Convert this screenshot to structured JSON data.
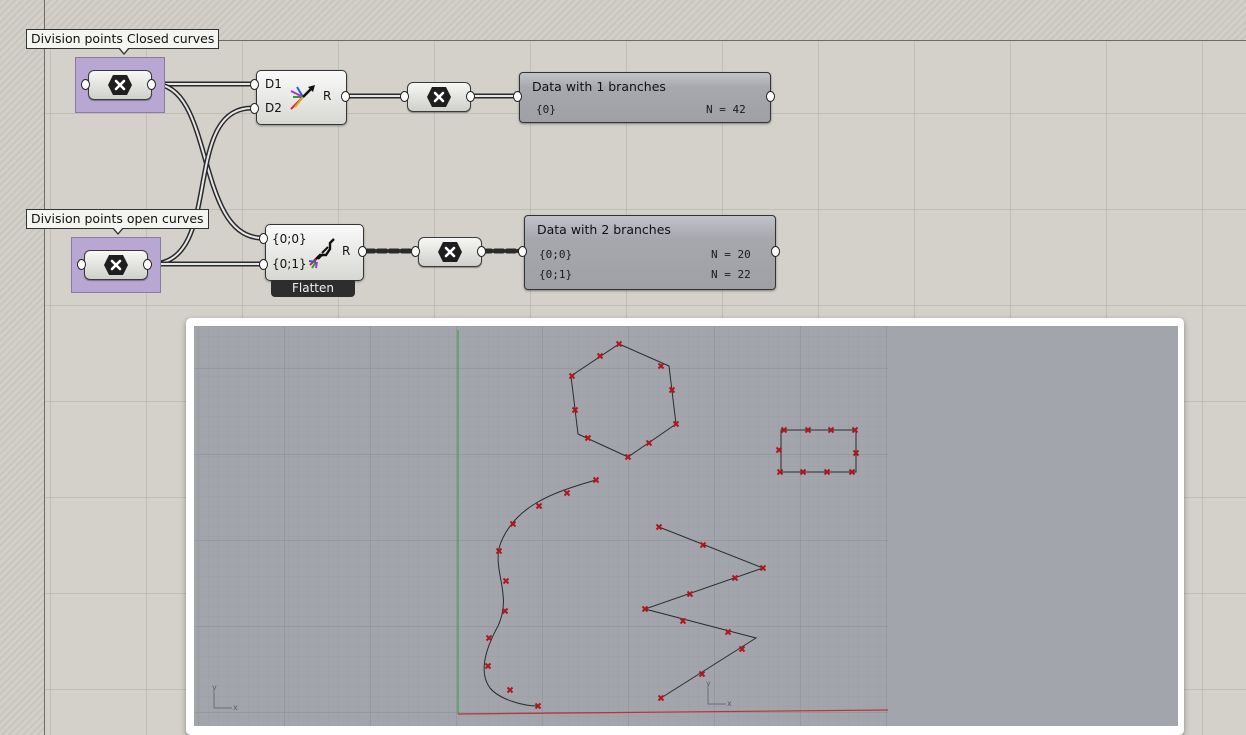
{
  "canvas": {
    "background": "#d3d1c9"
  },
  "tooltips": {
    "closed": "Division points Closed curves",
    "open": "Division points open curves"
  },
  "merge_component": {
    "inputs": [
      "D1",
      "D2"
    ],
    "output": "R",
    "icon": "merge-icon"
  },
  "flatten_component": {
    "inputs": [
      "{0;0}",
      "{0;1}"
    ],
    "output": "R",
    "label": "Flatten",
    "icon": "flatten-icon"
  },
  "panel_top": {
    "title": "Data with 1 branches",
    "rows": [
      {
        "path": "{0}",
        "count": "N = 42"
      }
    ]
  },
  "panel_bottom": {
    "title": "Data with 2 branches",
    "rows": [
      {
        "path": "{0;0}",
        "count": "N = 20"
      },
      {
        "path": "{0;1}",
        "count": "N = 22"
      }
    ]
  },
  "viewport": {
    "background": "#a2a5ab",
    "grid_color": "#8f939a",
    "curve_color": "#2b2b2b",
    "point_color": "#b0161d",
    "axis_y_color": "#3aa04a",
    "axis_x_color": "#c0303a",
    "axis_label_x": "x",
    "axis_label_y": "y"
  },
  "colors": {
    "param_fill": "#b9a7d3",
    "panel_fill": "#a7a8ae",
    "wire": "#2a2a2a"
  }
}
